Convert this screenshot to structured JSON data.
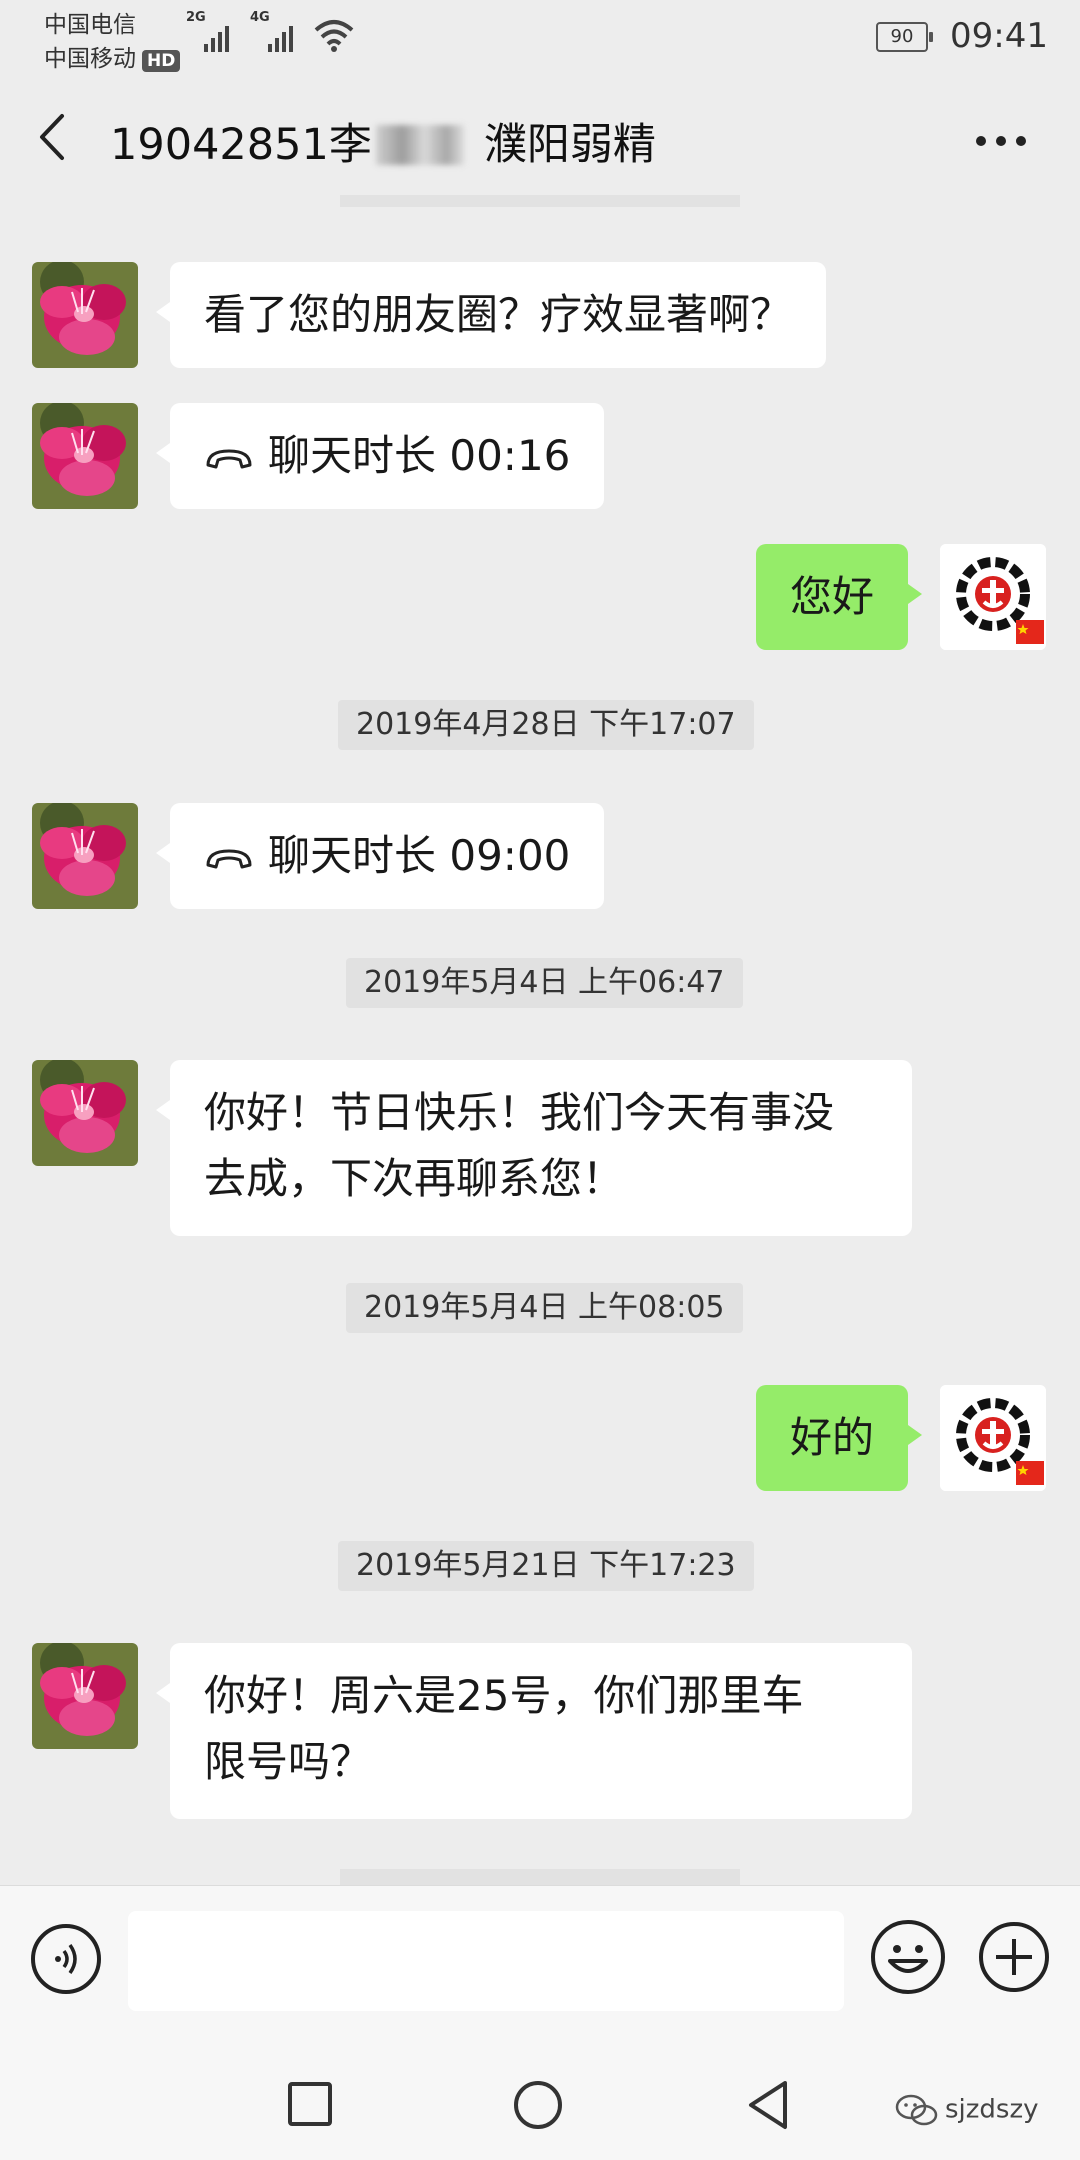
{
  "status_bar": {
    "carrier1": "中国电信",
    "carrier2": "中国移动",
    "hd": "HD",
    "signal1": "2G",
    "signal2": "4G",
    "battery": "90",
    "time": "09:41"
  },
  "header": {
    "title_prefix": "19042851李",
    "title_suffix": "濮阳弱精"
  },
  "messages": {
    "m1": "看了您的朋友圈？疗效显著啊？",
    "m2": "聊天时长 00:16",
    "m3": "您好",
    "ts1": "2019年4月28日 下午17:07",
    "m4": "聊天时长 09:00",
    "ts2": "2019年5月4日 上午06:47",
    "m5_line1": "你好！节日快乐！我们今天有事没",
    "m5_line2": "去成，下次再聊系您！",
    "ts3": "2019年5月4日 上午08:05",
    "m6": "好的",
    "ts4": "2019年5月21日 下午17:23",
    "m7_line1": "你好！周六是25号，你们那里车",
    "m7_line2": "限号吗？"
  },
  "watermark": "sjzdszy",
  "colors": {
    "background": "#ededed",
    "sent_bubble": "#95ec69",
    "received_bubble": "#ffffff"
  }
}
